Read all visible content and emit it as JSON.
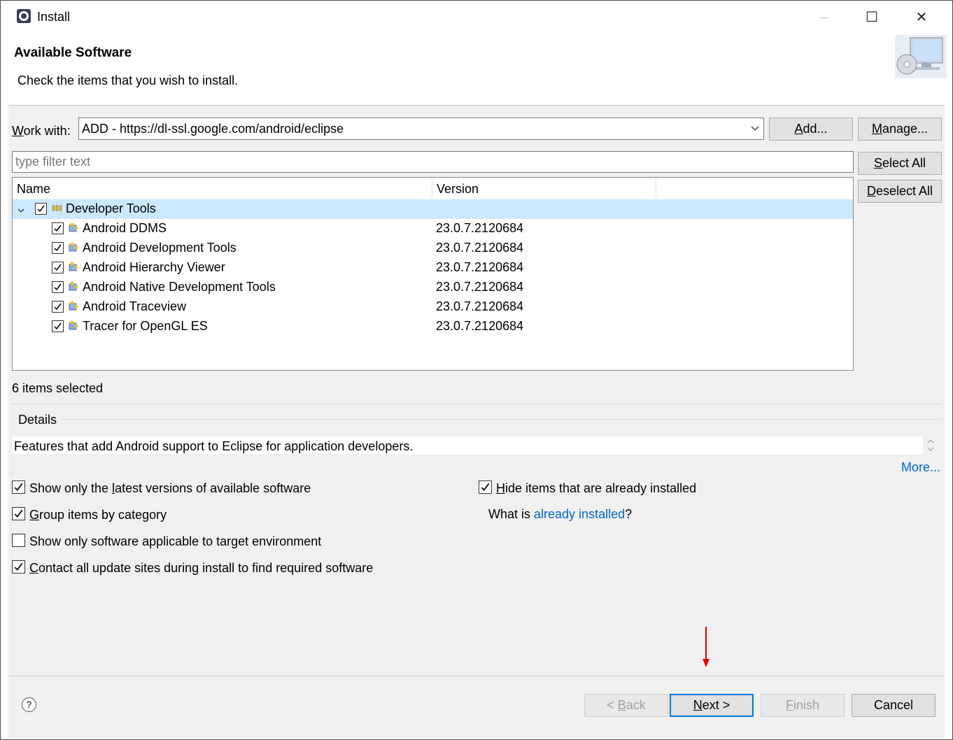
{
  "window": {
    "title": "Install",
    "minimize": "—",
    "maximize": "☐",
    "close": "✕"
  },
  "header": {
    "title": "Available Software",
    "description": "Check the items that you wish to install."
  },
  "work_with": {
    "label_pre": "",
    "label_underline": "W",
    "label_post": "ork with:",
    "value": "ADD - https://dl-ssl.google.com/android/eclipse",
    "add_underline": "A",
    "add_post": "dd...",
    "manage_underline": "M",
    "manage_post": "anage..."
  },
  "filter": {
    "placeholder": "type filter text",
    "select_all_underline": "S",
    "select_all_post": "elect All",
    "deselect_all_underline": "D",
    "deselect_all_post": "eselect All"
  },
  "tree": {
    "columns": [
      "Name",
      "Version"
    ],
    "category": "Developer Tools",
    "items": [
      {
        "name": "Android DDMS",
        "version": "23.0.7.2120684"
      },
      {
        "name": "Android Development Tools",
        "version": "23.0.7.2120684"
      },
      {
        "name": "Android Hierarchy Viewer",
        "version": "23.0.7.2120684"
      },
      {
        "name": "Android Native Development Tools",
        "version": "23.0.7.2120684"
      },
      {
        "name": "Android Traceview",
        "version": "23.0.7.2120684"
      },
      {
        "name": "Tracer for OpenGL ES",
        "version": "23.0.7.2120684"
      }
    ]
  },
  "status": "6 items selected",
  "details": {
    "label": "Details",
    "text": "Features that add Android support to Eclipse for application developers.",
    "more": "More..."
  },
  "options": {
    "latest_pre": "Show only the ",
    "latest_u": "l",
    "latest_post": "atest versions of available software",
    "group_u": "G",
    "group_post": "roup items by category",
    "target": "Show only software applicable to target environment",
    "contact_u": "C",
    "contact_post": "ontact all update sites during install to find required software",
    "hide_u": "H",
    "hide_post": "ide items that are already installed",
    "what_is": "What is ",
    "already_installed": "already installed",
    "q": "?"
  },
  "footer": {
    "help": "?",
    "back_pre": "< ",
    "back_u": "B",
    "back_post": "ack",
    "next_u": "N",
    "next_post": "ext >",
    "finish_u": "F",
    "finish_post": "inish",
    "cancel": "Cancel"
  },
  "colors": {
    "accent": "#0078d7",
    "selection": "#cce8ff",
    "link": "#0066cc",
    "annotation_arrow": "#e00000"
  }
}
